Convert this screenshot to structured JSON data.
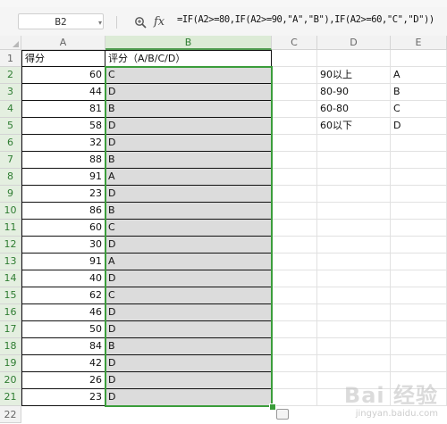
{
  "name_box": "B2",
  "fx_label": "fx",
  "formula": "=IF(A2>=80,IF(A2>=90,\"A\",\"B\"),IF(A2>=60,\"C\",\"D\"))",
  "columns": [
    "A",
    "B",
    "C",
    "D",
    "E"
  ],
  "selected_column": "B",
  "header_row": {
    "a": "得分",
    "b": "评分（A/B/C/D）"
  },
  "rows": [
    {
      "num": "2",
      "score": "60",
      "grade": "C",
      "d": "90以上",
      "e": "A"
    },
    {
      "num": "3",
      "score": "44",
      "grade": "D",
      "d": "80-90",
      "e": "B"
    },
    {
      "num": "4",
      "score": "81",
      "grade": "B",
      "d": "60-80",
      "e": "C"
    },
    {
      "num": "5",
      "score": "58",
      "grade": "D",
      "d": "60以下",
      "e": "D"
    },
    {
      "num": "6",
      "score": "32",
      "grade": "D",
      "d": "",
      "e": ""
    },
    {
      "num": "7",
      "score": "88",
      "grade": "B",
      "d": "",
      "e": ""
    },
    {
      "num": "8",
      "score": "91",
      "grade": "A",
      "d": "",
      "e": ""
    },
    {
      "num": "9",
      "score": "23",
      "grade": "D",
      "d": "",
      "e": ""
    },
    {
      "num": "10",
      "score": "86",
      "grade": "B",
      "d": "",
      "e": ""
    },
    {
      "num": "11",
      "score": "60",
      "grade": "C",
      "d": "",
      "e": ""
    },
    {
      "num": "12",
      "score": "30",
      "grade": "D",
      "d": "",
      "e": ""
    },
    {
      "num": "13",
      "score": "91",
      "grade": "A",
      "d": "",
      "e": ""
    },
    {
      "num": "14",
      "score": "40",
      "grade": "D",
      "d": "",
      "e": ""
    },
    {
      "num": "15",
      "score": "62",
      "grade": "C",
      "d": "",
      "e": ""
    },
    {
      "num": "16",
      "score": "46",
      "grade": "D",
      "d": "",
      "e": ""
    },
    {
      "num": "17",
      "score": "50",
      "grade": "D",
      "d": "",
      "e": ""
    },
    {
      "num": "18",
      "score": "84",
      "grade": "B",
      "d": "",
      "e": ""
    },
    {
      "num": "19",
      "score": "42",
      "grade": "D",
      "d": "",
      "e": ""
    },
    {
      "num": "20",
      "score": "26",
      "grade": "D",
      "d": "",
      "e": ""
    },
    {
      "num": "21",
      "score": "23",
      "grade": "D",
      "d": "",
      "e": ""
    }
  ],
  "next_row_num": "22",
  "watermark": "Bai 经验",
  "watermark_sub": "jingyan.baidu.com",
  "colors": {
    "selection": "#3b9d3b",
    "selected_fill": "#dcdcdc"
  }
}
